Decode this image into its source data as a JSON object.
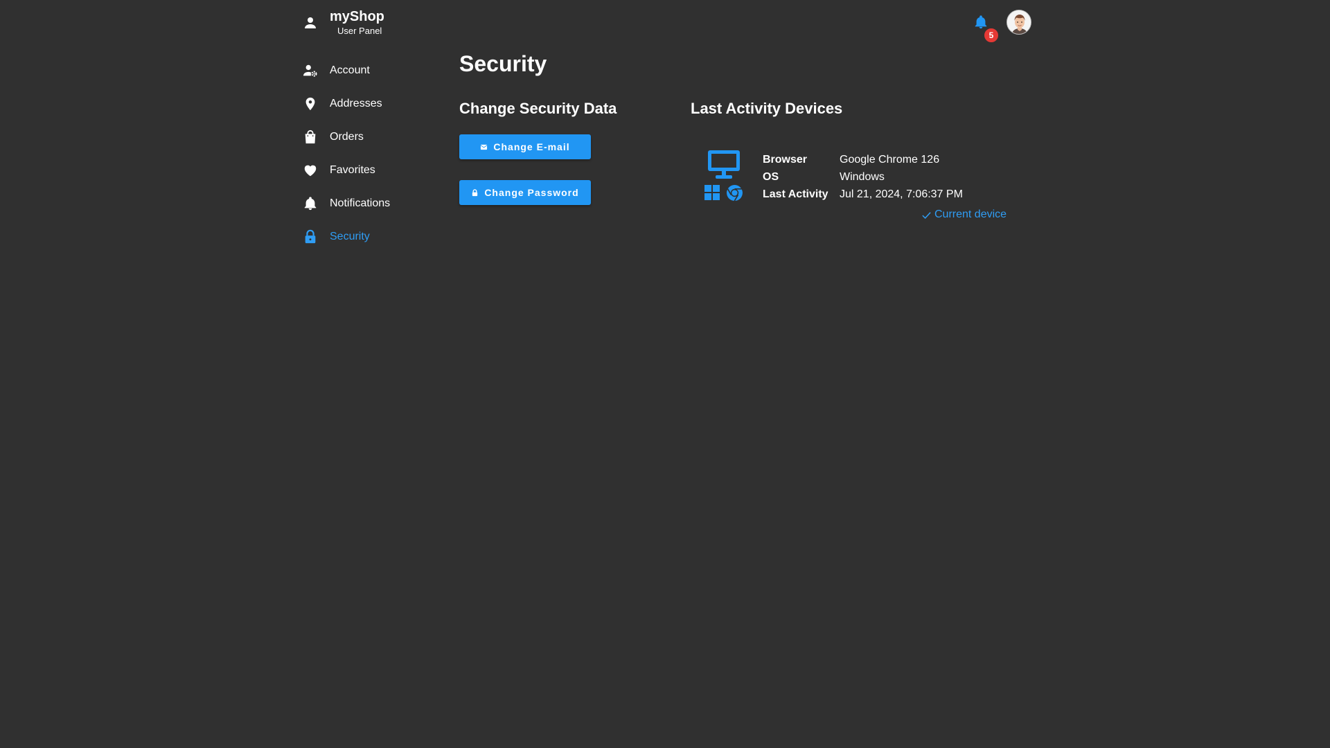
{
  "brand": {
    "title": "myShop",
    "subtitle": "User Panel",
    "icon": "person-icon"
  },
  "header": {
    "notification_count": "5",
    "bell_icon": "bell-icon",
    "avatar": "user-avatar"
  },
  "sidebar": {
    "items": [
      {
        "label": "Account",
        "icon": "account-settings-icon"
      },
      {
        "label": "Addresses",
        "icon": "map-pin-icon"
      },
      {
        "label": "Orders",
        "icon": "shopping-bag-icon"
      },
      {
        "label": "Favorites",
        "icon": "heart-icon"
      },
      {
        "label": "Notifications",
        "icon": "bell-icon"
      },
      {
        "label": "Security",
        "icon": "lock-icon",
        "active": true
      }
    ]
  },
  "main": {
    "title": "Security",
    "change_section": {
      "title": "Change Security Data",
      "email_button": "Change E-mail",
      "password_button": "Change Password"
    },
    "devices_section": {
      "title": "Last Activity Devices",
      "device": {
        "rows": [
          {
            "key": "Browser",
            "value": "Google Chrome 126"
          },
          {
            "key": "OS",
            "value": "Windows"
          },
          {
            "key": "Last Activity",
            "value": "Jul 21, 2024, 7:06:37 PM"
          }
        ],
        "current_label": "Current device",
        "icons": [
          "monitor-icon",
          "windows-icon",
          "chrome-icon"
        ]
      }
    }
  },
  "colors": {
    "background": "#303030",
    "accent": "#2196f3",
    "badge": "#e53935"
  }
}
